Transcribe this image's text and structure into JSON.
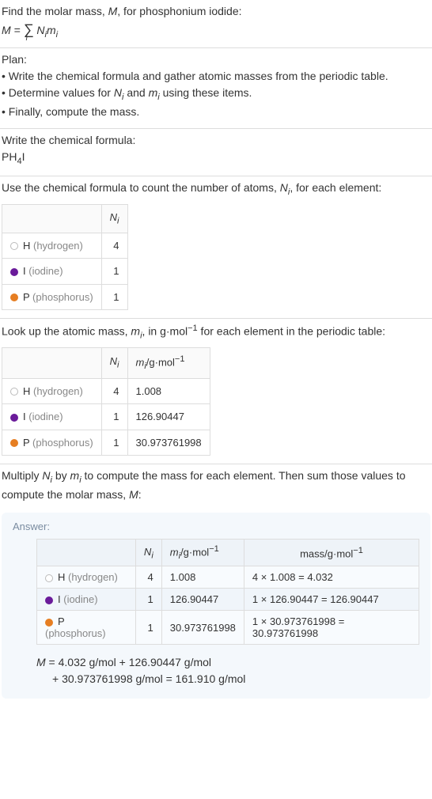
{
  "intro": {
    "line1_a": "Find the molar mass, ",
    "line1_m": "M",
    "line1_b": ", for phosphonium iodide:",
    "eq_left_M": "M",
    "eq_equals": " = ",
    "eq_sigma": "∑",
    "eq_idx": "i",
    "eq_right": " N",
    "eq_right_i": "i",
    "eq_right_m": "m",
    "eq_right_mi": "i"
  },
  "plan": {
    "title": "Plan:",
    "b1": "• Write the chemical formula and gather atomic masses from the periodic table.",
    "b2_a": "• Determine values for ",
    "b2_N": "N",
    "b2_Ni": "i",
    "b2_and": " and ",
    "b2_m": "m",
    "b2_mi": "i",
    "b2_b": " using these items.",
    "b3": "• Finally, compute the mass."
  },
  "formula_section": {
    "title": "Write the chemical formula:",
    "PH": "PH",
    "four": "4",
    "I": "I"
  },
  "count_section": {
    "title_a": "Use the chemical formula to count the number of atoms, ",
    "title_N": "N",
    "title_Ni": "i",
    "title_b": ", for each element:",
    "header_N": "N",
    "header_Ni": "i",
    "rows": [
      {
        "color": "#ffffff",
        "border": "#bbb",
        "sym": "H",
        "name": " (hydrogen)",
        "n": "4"
      },
      {
        "color": "#6a1b9a",
        "border": "#6a1b9a",
        "sym": "I",
        "name": " (iodine)",
        "n": "1"
      },
      {
        "color": "#e67e22",
        "border": "#e67e22",
        "sym": "P",
        "name": " (phosphorus)",
        "n": "1"
      }
    ]
  },
  "mass_section": {
    "title_a": "Look up the atomic mass, ",
    "title_m": "m",
    "title_mi": "i",
    "title_b": ", in g·mol",
    "title_exp": "−1",
    "title_c": " for each element in the periodic table:",
    "h_N": "N",
    "h_Ni": "i",
    "h_m": "m",
    "h_mi": "i",
    "h_unit": "/g·mol",
    "h_exp": "−1",
    "rows": [
      {
        "color": "#ffffff",
        "border": "#bbb",
        "sym": "H",
        "name": " (hydrogen)",
        "n": "4",
        "m": "1.008"
      },
      {
        "color": "#6a1b9a",
        "border": "#6a1b9a",
        "sym": "I",
        "name": " (iodine)",
        "n": "1",
        "m": "126.90447"
      },
      {
        "color": "#e67e22",
        "border": "#e67e22",
        "sym": "P",
        "name": " (phosphorus)",
        "n": "1",
        "m": "30.973761998"
      }
    ]
  },
  "mult_section": {
    "line_a": "Multiply ",
    "N": "N",
    "Ni": "i",
    "by": " by ",
    "m": "m",
    "mi": "i",
    "line_b": " to compute the mass for each element. Then sum those values to compute the molar mass, ",
    "M": "M",
    "colon": ":"
  },
  "answer": {
    "label": "Answer:",
    "h_N": "N",
    "h_Ni": "i",
    "h_m": "m",
    "h_mi": "i",
    "h_munit": "/g·mol",
    "h_mexp": "−1",
    "h_mass": "mass/g·mol",
    "h_massexp": "−1",
    "rows": [
      {
        "color": "#ffffff",
        "border": "#bbb",
        "sym": "H",
        "name": " (hydrogen)",
        "n": "4",
        "m": "1.008",
        "calc": "4 × 1.008 = 4.032"
      },
      {
        "color": "#6a1b9a",
        "border": "#6a1b9a",
        "sym": "I",
        "name": " (iodine)",
        "n": "1",
        "m": "126.90447",
        "calc": "1 × 126.90447 = 126.90447"
      },
      {
        "color": "#e67e22",
        "border": "#e67e22",
        "sym": "P",
        "name": " (phosphorus)",
        "n": "1",
        "m": "30.973761998",
        "calc": "1 × 30.973761998 = 30.973761998"
      }
    ],
    "final_M": "M",
    "final_eq": " = 4.032 g/mol + 126.90447 g/mol",
    "final_line2": "+ 30.973761998 g/mol = 161.910 g/mol"
  }
}
